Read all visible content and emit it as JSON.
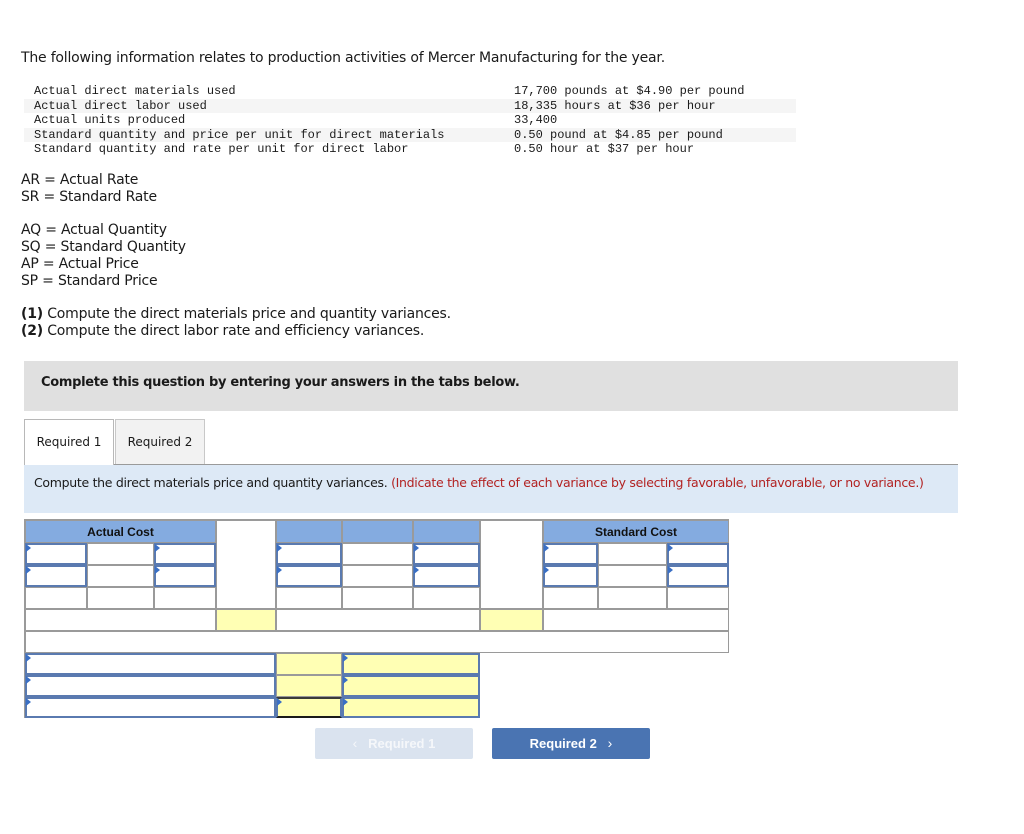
{
  "intro": "The following information relates to production activities of Mercer Manufacturing for the year.",
  "info_rows": [
    {
      "label": "Actual direct materials used",
      "value": "17,700 pounds at $4.90 per pound"
    },
    {
      "label": "Actual direct labor used",
      "value": "18,335 hours at $36 per hour"
    },
    {
      "label": "Actual units produced",
      "value": "33,400"
    },
    {
      "label": "Standard quantity and price per unit for direct materials",
      "value": "0.50 pound at $4.85 per pound"
    },
    {
      "label": "Standard quantity and rate per unit for direct labor",
      "value": "0.50 hour at $37 per hour"
    }
  ],
  "abbreviations_rate": [
    "AR = Actual Rate",
    "SR = Standard Rate"
  ],
  "abbreviations_qty": [
    "AQ = Actual Quantity",
    "SQ = Standard Quantity",
    "AP = Actual Price",
    "SP = Standard Price"
  ],
  "requirements": [
    {
      "num": "(1)",
      "text": " Compute the direct materials price and quantity variances."
    },
    {
      "num": "(2)",
      "text": " Compute the direct labor rate and efficiency variances."
    }
  ],
  "banner": "Complete this question by entering your answers in the tabs below.",
  "tabs": [
    {
      "label": "Required 1",
      "active": true
    },
    {
      "label": "Required 2",
      "active": false
    }
  ],
  "instruction": {
    "main": "Compute the direct materials price and quantity variances. ",
    "note": "(Indicate the effect of each variance by selecting favorable, unfavorable, or no variance.)"
  },
  "worksheet": {
    "actual_cost_header": "Actual Cost",
    "standard_cost_header": "Standard Cost"
  },
  "nav": {
    "prev_label": "Required 1",
    "next_label": "Required 2",
    "prev_icon": "chevron-left-icon",
    "next_icon": "chevron-right-icon"
  },
  "colors": {
    "header_blue": "#84abe0",
    "input_yellow": "#ffffb4",
    "instruction_bg": "#dde9f6",
    "note_red": "#b22222",
    "next_button": "#4a74b2"
  }
}
